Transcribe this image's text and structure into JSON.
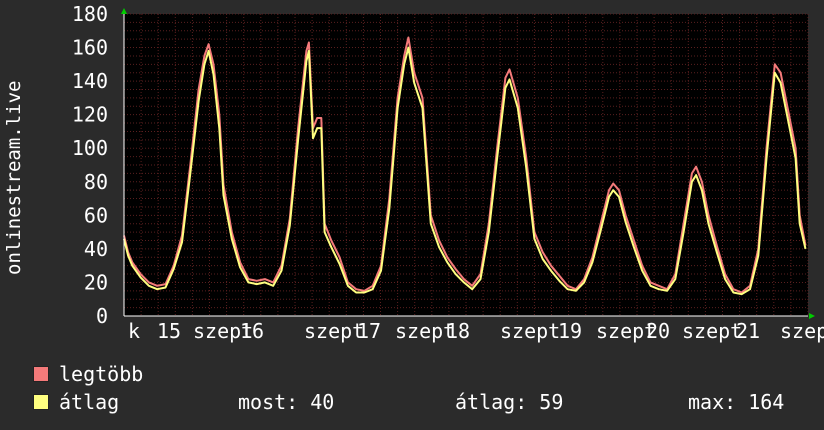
{
  "chart_data": {
    "type": "line",
    "ylabel": "onlinestream.live",
    "ylim": [
      0,
      180
    ],
    "yticks": [
      0,
      20,
      40,
      60,
      80,
      100,
      120,
      140,
      160,
      180
    ],
    "xtick_labels": [
      "k",
      "15",
      "szept",
      "16",
      "szept",
      "17",
      "szept",
      "18",
      "szept",
      "19",
      "szept",
      "20",
      "szept",
      "21",
      "szept"
    ],
    "grid": true,
    "colors": {
      "background": "#2b2b2b",
      "plot": "#000000",
      "legtobb": "#f47a7a",
      "atlag": "#ffff80",
      "grid": "#6a2a2a",
      "axis": "#ffffff",
      "arrow": "#00cc00"
    },
    "x_range": [
      0,
      7
    ],
    "series": [
      {
        "name": "legtöbb",
        "color": "#f47a7a",
        "points": [
          [
            0,
            48
          ],
          [
            0.05,
            38
          ],
          [
            0.1,
            32
          ],
          [
            0.2,
            25
          ],
          [
            0.3,
            20
          ],
          [
            0.4,
            18
          ],
          [
            0.5,
            19
          ],
          [
            0.6,
            30
          ],
          [
            0.7,
            48
          ],
          [
            0.8,
            90
          ],
          [
            0.9,
            135
          ],
          [
            0.97,
            155
          ],
          [
            1.02,
            162
          ],
          [
            1.08,
            150
          ],
          [
            1.15,
            120
          ],
          [
            1.2,
            78
          ],
          [
            1.3,
            50
          ],
          [
            1.4,
            32
          ],
          [
            1.5,
            22
          ],
          [
            1.6,
            21
          ],
          [
            1.7,
            22
          ],
          [
            1.8,
            20
          ],
          [
            1.9,
            30
          ],
          [
            2.0,
            58
          ],
          [
            2.1,
            112
          ],
          [
            2.2,
            158
          ],
          [
            2.23,
            163
          ],
          [
            2.28,
            112
          ],
          [
            2.33,
            118
          ],
          [
            2.38,
            118
          ],
          [
            2.42,
            55
          ],
          [
            2.5,
            45
          ],
          [
            2.6,
            35
          ],
          [
            2.7,
            20
          ],
          [
            2.8,
            16
          ],
          [
            2.9,
            15
          ],
          [
            3.0,
            18
          ],
          [
            3.1,
            30
          ],
          [
            3.2,
            70
          ],
          [
            3.3,
            130
          ],
          [
            3.38,
            155
          ],
          [
            3.43,
            166
          ],
          [
            3.5,
            145
          ],
          [
            3.6,
            130
          ],
          [
            3.7,
            60
          ],
          [
            3.8,
            45
          ],
          [
            3.9,
            35
          ],
          [
            4.0,
            28
          ],
          [
            4.1,
            22
          ],
          [
            4.2,
            18
          ],
          [
            4.3,
            25
          ],
          [
            4.4,
            55
          ],
          [
            4.5,
            100
          ],
          [
            4.6,
            142
          ],
          [
            4.65,
            147
          ],
          [
            4.75,
            130
          ],
          [
            4.85,
            95
          ],
          [
            4.95,
            50
          ],
          [
            5.05,
            38
          ],
          [
            5.15,
            30
          ],
          [
            5.25,
            24
          ],
          [
            5.35,
            18
          ],
          [
            5.45,
            16
          ],
          [
            5.55,
            22
          ],
          [
            5.65,
            35
          ],
          [
            5.75,
            55
          ],
          [
            5.85,
            75
          ],
          [
            5.9,
            79
          ],
          [
            5.97,
            75
          ],
          [
            6.05,
            60
          ],
          [
            6.15,
            45
          ],
          [
            6.25,
            30
          ],
          [
            6.35,
            20
          ],
          [
            6.45,
            18
          ],
          [
            6.55,
            16
          ],
          [
            6.65,
            25
          ],
          [
            6.75,
            55
          ],
          [
            6.85,
            85
          ],
          [
            6.9,
            89
          ],
          [
            6.97,
            80
          ],
          [
            7.05,
            60
          ],
          [
            7.15,
            42
          ],
          [
            7.25,
            25
          ],
          [
            7.35,
            16
          ],
          [
            7.45,
            14
          ],
          [
            7.55,
            18
          ],
          [
            7.65,
            40
          ],
          [
            7.75,
            100
          ],
          [
            7.85,
            150
          ],
          [
            7.92,
            145
          ],
          [
            8.0,
            125
          ],
          [
            8.1,
            100
          ],
          [
            8.15,
            60
          ],
          [
            8.22,
            42
          ]
        ]
      },
      {
        "name": "átlag",
        "color": "#ffff80",
        "points": [
          [
            0,
            46
          ],
          [
            0.05,
            36
          ],
          [
            0.1,
            30
          ],
          [
            0.2,
            23
          ],
          [
            0.3,
            18
          ],
          [
            0.4,
            16
          ],
          [
            0.5,
            17
          ],
          [
            0.6,
            28
          ],
          [
            0.7,
            44
          ],
          [
            0.8,
            85
          ],
          [
            0.9,
            128
          ],
          [
            0.97,
            150
          ],
          [
            1.02,
            158
          ],
          [
            1.08,
            144
          ],
          [
            1.15,
            112
          ],
          [
            1.2,
            72
          ],
          [
            1.3,
            46
          ],
          [
            1.4,
            29
          ],
          [
            1.5,
            20
          ],
          [
            1.6,
            19
          ],
          [
            1.7,
            20
          ],
          [
            1.8,
            18
          ],
          [
            1.9,
            27
          ],
          [
            2.0,
            54
          ],
          [
            2.1,
            105
          ],
          [
            2.2,
            152
          ],
          [
            2.23,
            158
          ],
          [
            2.28,
            106
          ],
          [
            2.33,
            112
          ],
          [
            2.38,
            112
          ],
          [
            2.42,
            50
          ],
          [
            2.5,
            41
          ],
          [
            2.6,
            31
          ],
          [
            2.7,
            18
          ],
          [
            2.8,
            14
          ],
          [
            2.9,
            14
          ],
          [
            3.0,
            16
          ],
          [
            3.1,
            27
          ],
          [
            3.2,
            64
          ],
          [
            3.3,
            124
          ],
          [
            3.38,
            150
          ],
          [
            3.43,
            160
          ],
          [
            3.5,
            139
          ],
          [
            3.6,
            124
          ],
          [
            3.7,
            55
          ],
          [
            3.8,
            41
          ],
          [
            3.9,
            32
          ],
          [
            4.0,
            25
          ],
          [
            4.1,
            20
          ],
          [
            4.2,
            16
          ],
          [
            4.3,
            22
          ],
          [
            4.4,
            50
          ],
          [
            4.5,
            94
          ],
          [
            4.6,
            136
          ],
          [
            4.65,
            141
          ],
          [
            4.75,
            124
          ],
          [
            4.85,
            89
          ],
          [
            4.95,
            46
          ],
          [
            5.05,
            34
          ],
          [
            5.15,
            27
          ],
          [
            5.25,
            21
          ],
          [
            5.35,
            16
          ],
          [
            5.45,
            15
          ],
          [
            5.55,
            20
          ],
          [
            5.65,
            32
          ],
          [
            5.75,
            51
          ],
          [
            5.85,
            71
          ],
          [
            5.9,
            75
          ],
          [
            5.97,
            71
          ],
          [
            6.05,
            56
          ],
          [
            6.15,
            41
          ],
          [
            6.25,
            27
          ],
          [
            6.35,
            18
          ],
          [
            6.45,
            16
          ],
          [
            6.55,
            15
          ],
          [
            6.65,
            22
          ],
          [
            6.75,
            50
          ],
          [
            6.85,
            80
          ],
          [
            6.9,
            84
          ],
          [
            6.97,
            75
          ],
          [
            7.05,
            55
          ],
          [
            7.15,
            38
          ],
          [
            7.25,
            22
          ],
          [
            7.35,
            14
          ],
          [
            7.45,
            13
          ],
          [
            7.55,
            16
          ],
          [
            7.65,
            36
          ],
          [
            7.75,
            94
          ],
          [
            7.85,
            145
          ],
          [
            7.92,
            139
          ],
          [
            8.0,
            119
          ],
          [
            8.1,
            94
          ],
          [
            8.15,
            55
          ],
          [
            8.22,
            40
          ]
        ]
      }
    ]
  },
  "legend": {
    "items": [
      {
        "label": "legtöbb",
        "color": "#f47a7a"
      },
      {
        "label": "átlag",
        "color": "#ffff80"
      }
    ],
    "stats": {
      "most": "most: 40",
      "atlag": "átlag: 59",
      "max": "max: 164"
    }
  }
}
